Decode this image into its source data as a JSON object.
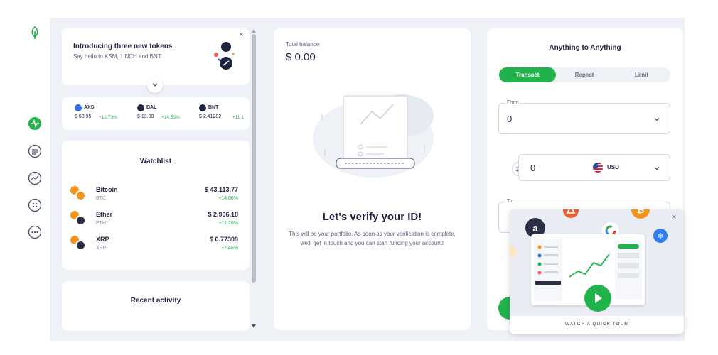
{
  "promo": {
    "title": "Introducing three new tokens",
    "subtitle": "Say hello to KSM, 1INCH and BNT",
    "close": "×"
  },
  "ticker": [
    {
      "symbol": "AXS",
      "price": "$ 53.95",
      "change": "+12.73%",
      "color": "#2f6de0"
    },
    {
      "symbol": "BAL",
      "price": "$ 13.08",
      "change": "+14.53%",
      "color": "#1f2440"
    },
    {
      "symbol": "BNT",
      "price": "$ 2.41282",
      "change": "+11.1",
      "color": "#1f2440"
    }
  ],
  "watchlist": {
    "title": "Watchlist",
    "items": [
      {
        "name": "Bitcoin",
        "symbol": "BTC",
        "price": "$ 43,113.77",
        "change": "+14.06%",
        "color": "#f7931a"
      },
      {
        "name": "Ether",
        "symbol": "ETH",
        "price": "$ 2,906.18",
        "change": "+11.26%",
        "color": "#2a2f45"
      },
      {
        "name": "XRP",
        "symbol": "XRP",
        "price": "$ 0.77309",
        "change": "+7.46%",
        "color": "#2a2f45"
      }
    ]
  },
  "recent": {
    "title": "Recent activity"
  },
  "balance": {
    "label": "Total balance",
    "value": "$ 0.00"
  },
  "verify": {
    "title": "Let's verify your ID!",
    "body": "This will be your portfolio. As soon as your verification is complete, we'll get in touch and you can start funding your account!"
  },
  "trade": {
    "title": "Anything to Anything",
    "tabs": [
      "Transact",
      "Repeat",
      "Limit"
    ],
    "active_tab": "Transact",
    "from_label": "From",
    "from_value": "0",
    "amount_value": "0",
    "currency": "USD",
    "to_label": "To"
  },
  "tour": {
    "label": "WATCH A QUICK TOUR",
    "close": "×"
  },
  "colors": {
    "accent": "#22b24c",
    "background": "#eef1f6",
    "text": "#1f2440"
  }
}
